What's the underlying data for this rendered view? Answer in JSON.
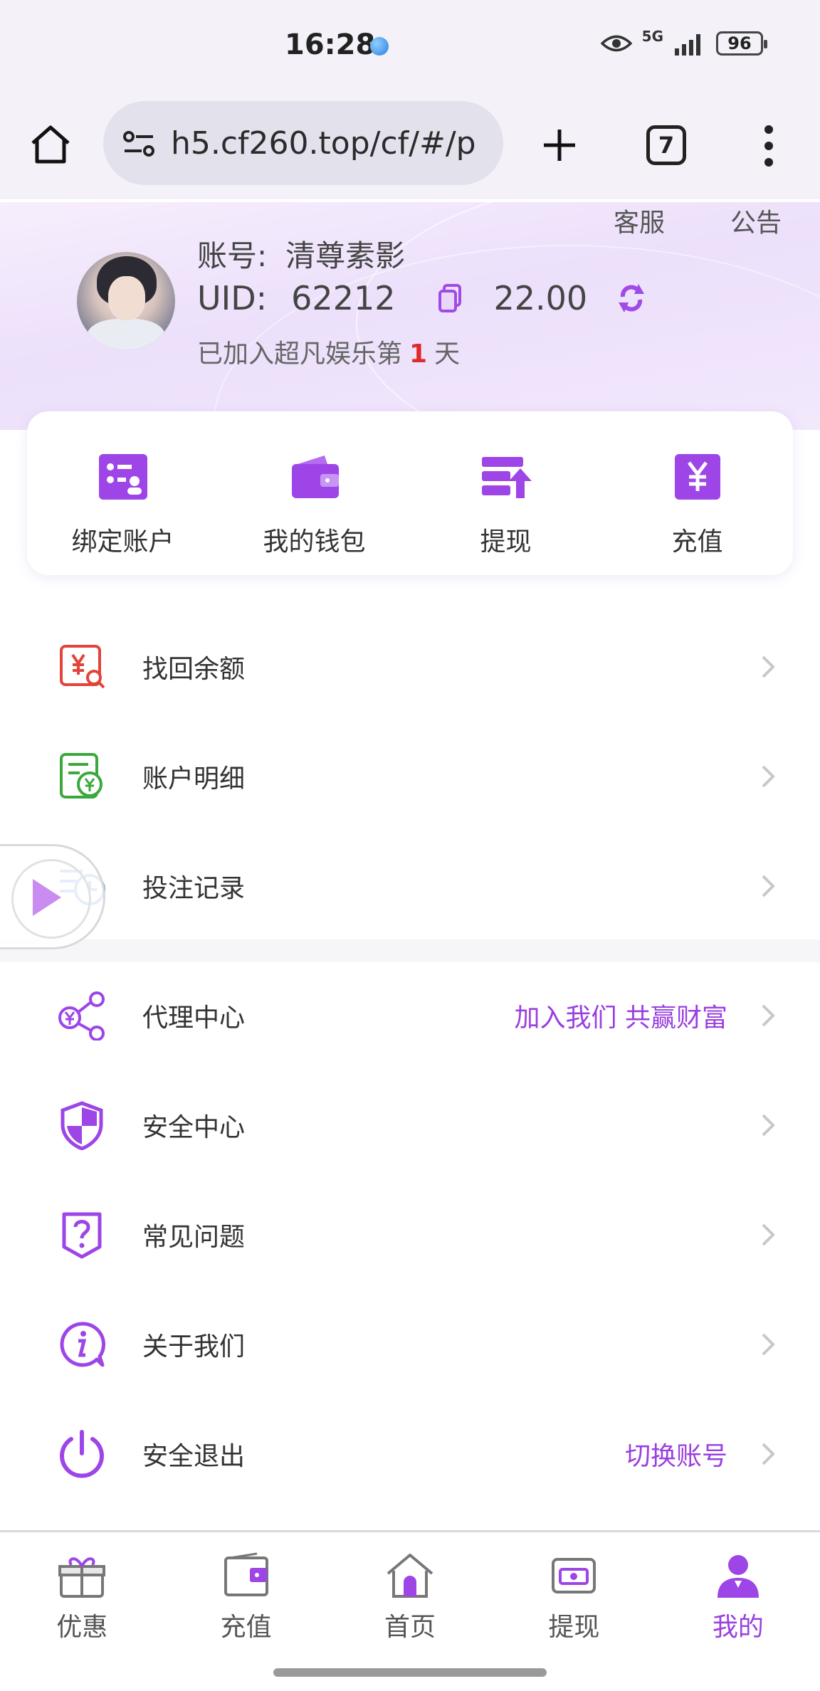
{
  "status_bar": {
    "time": "16:28",
    "network": "5G",
    "battery": "96"
  },
  "browser": {
    "url": "h5.cf260.top/cf/#/p",
    "tab_count": "7",
    "load_progress_percent": 10
  },
  "profile": {
    "top_links": [
      "客服",
      "公告"
    ],
    "account_label": "账号:",
    "account_name": "清尊素影",
    "uid_label": "UID:",
    "uid_value": "62212",
    "balance": "22.00",
    "joined_prefix": "已加入超凡娱乐第",
    "joined_days": "1",
    "joined_suffix": "天"
  },
  "quick_actions": [
    {
      "label": "绑定账户",
      "icon": "bind-account-icon"
    },
    {
      "label": "我的钱包",
      "icon": "wallet-icon"
    },
    {
      "label": "提现",
      "icon": "withdraw-icon"
    },
    {
      "label": "充值",
      "icon": "yuan-icon"
    }
  ],
  "menu": [
    {
      "label": "找回余额",
      "icon": "recover-balance-icon",
      "extra": ""
    },
    {
      "label": "账户明细",
      "icon": "account-detail-icon",
      "extra": ""
    },
    {
      "label": "投注记录",
      "icon": "bet-record-icon",
      "extra": ""
    },
    {
      "label": "代理中心",
      "icon": "agent-share-icon",
      "extra": "加入我们 共赢财富"
    },
    {
      "label": "安全中心",
      "icon": "shield-icon",
      "extra": ""
    },
    {
      "label": "常见问题",
      "icon": "question-icon",
      "extra": ""
    },
    {
      "label": "关于我们",
      "icon": "info-icon",
      "extra": ""
    },
    {
      "label": "安全退出",
      "icon": "power-icon",
      "extra": "切换账号"
    }
  ],
  "bottom_nav": [
    {
      "label": "优惠",
      "icon": "gift-icon"
    },
    {
      "label": "充值",
      "icon": "wallet-icon"
    },
    {
      "label": "首页",
      "icon": "home-icon"
    },
    {
      "label": "提现",
      "icon": "withdraw-cash-icon"
    },
    {
      "label": "我的",
      "icon": "user-icon",
      "active": true
    }
  ],
  "colors": {
    "accent": "#9a3fe0",
    "highlight_red": "#e02a2a"
  }
}
